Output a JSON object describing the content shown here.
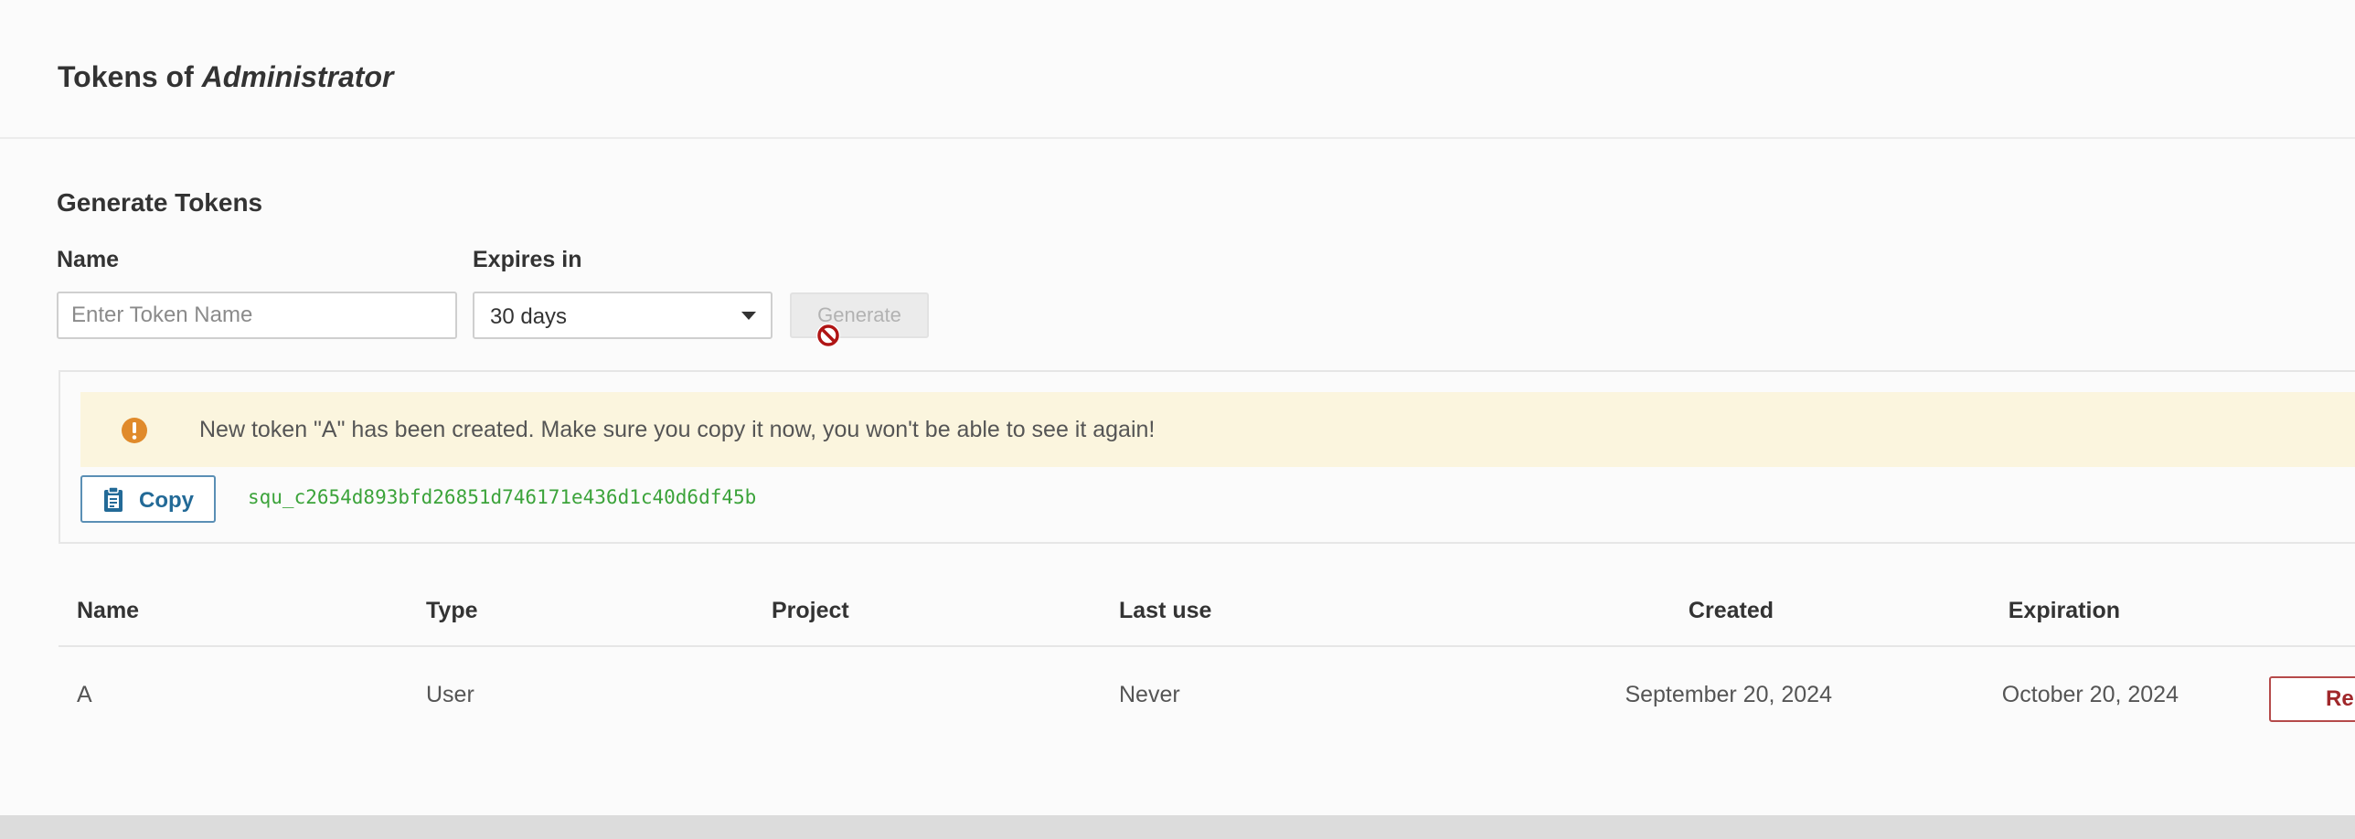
{
  "modal": {
    "title_prefix": "Tokens of",
    "title_user": "Administrator"
  },
  "generate": {
    "section_title": "Generate Tokens",
    "name_label": "Name",
    "name_placeholder": "Enter Token Name",
    "name_value": "",
    "expires_label": "Expires in",
    "expires_value": "30 days",
    "generate_label": "Generate",
    "generate_enabled": false
  },
  "new_token": {
    "alert_text": "New token \"A\" has been created. Make sure you copy it now, you won't be able to see it again!",
    "alert_icon": "warning-circle-icon",
    "copy_label": "Copy",
    "copy_icon": "clipboard-icon",
    "token_value": "squ_c2654d893bfd26851d746171e436d1c40d6df45b"
  },
  "table": {
    "headers": {
      "name": "Name",
      "type": "Type",
      "project": "Project",
      "last_use": "Last use",
      "created": "Created",
      "expiration": "Expiration"
    },
    "rows": [
      {
        "name": "A",
        "type": "User",
        "project": "",
        "last_use": "Never",
        "created": "September 20, 2024",
        "expiration": "October 20, 2024",
        "action_label": "Re"
      }
    ]
  },
  "colors": {
    "token_text": "#3ba33a",
    "alert_background": "#fbf5de",
    "alert_icon": "#e08a2b",
    "copy_button": "#236a97",
    "revoke_button": "#a0282b"
  }
}
